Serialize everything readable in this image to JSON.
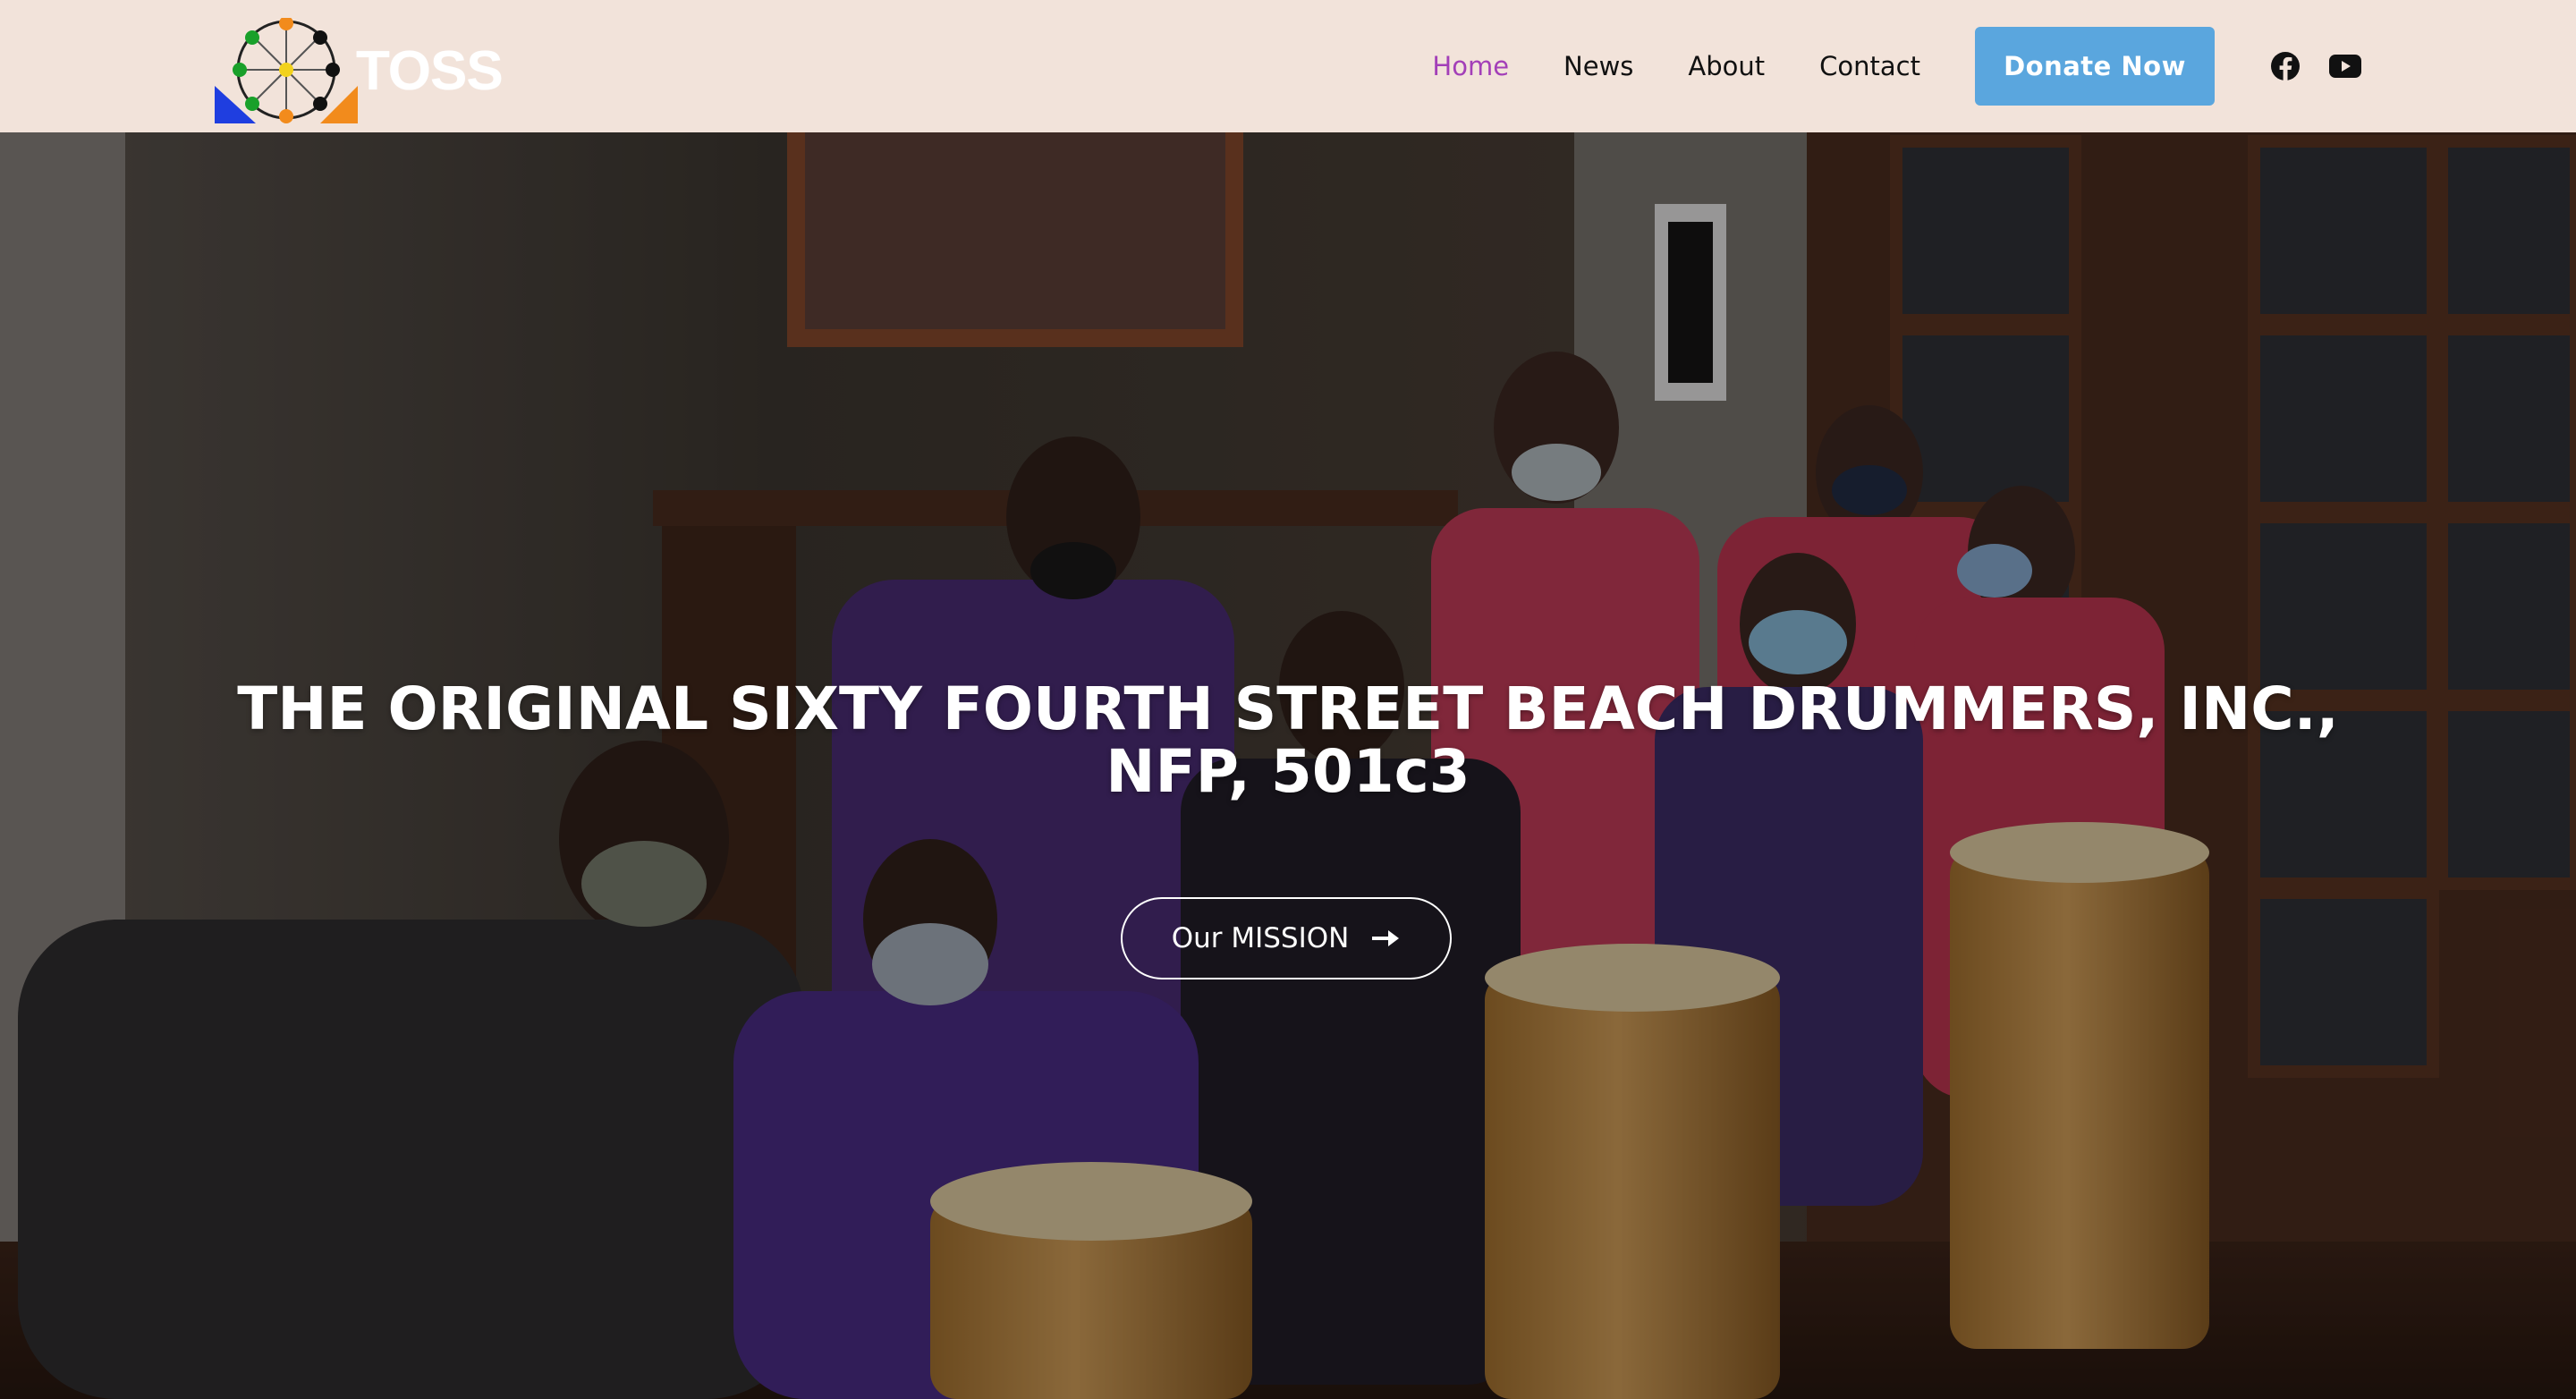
{
  "header": {
    "logo_text": "TOSS",
    "nav": [
      {
        "label": "Home",
        "active": true
      },
      {
        "label": "News",
        "active": false
      },
      {
        "label": "About",
        "active": false
      },
      {
        "label": "Contact",
        "active": false
      }
    ],
    "donate_label": "Donate Now",
    "social_icons": [
      "facebook-icon",
      "youtube-icon"
    ]
  },
  "hero": {
    "title": "THE ORIGINAL SIXTY FOURTH STREET BEACH DRUMMERS, INC., NFP, 501c3",
    "cta_label": "Our MISSION",
    "cta_icon": "arrow-right-icon"
  },
  "colors": {
    "header_bg": "#f2e3da",
    "nav_active": "#a33fb8",
    "donate_bg": "#5aa6de"
  }
}
